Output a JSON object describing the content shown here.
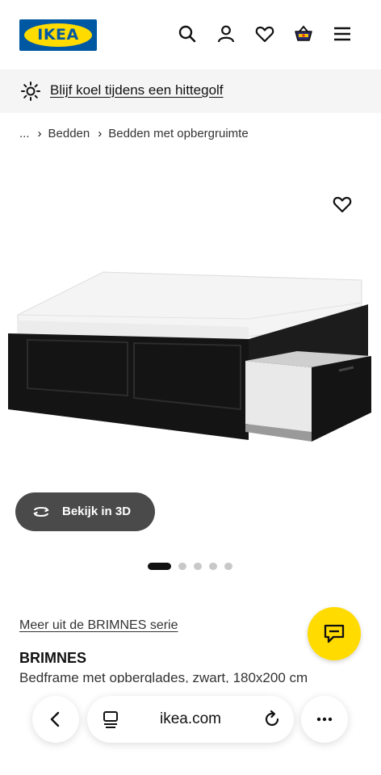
{
  "header": {
    "logo_text": "IKEA",
    "icons": [
      "search-icon",
      "account-icon",
      "favourites-icon",
      "basket-icon",
      "menu-icon"
    ],
    "brand_colors": {
      "blue": "#0058a3",
      "yellow": "#ffdb00"
    }
  },
  "banner": {
    "icon": "sun-icon",
    "text": "Blijf koel tijdens een hittegolf"
  },
  "breadcrumb": {
    "ellipsis": "...",
    "items": [
      "Bedden",
      "Bedden met opbergruimte"
    ]
  },
  "gallery": {
    "view_3d_label": "Bekijk in 3D",
    "image_count": 5,
    "active_image": 1
  },
  "product": {
    "series_link": "Meer uit de BRIMNES serie",
    "name": "BRIMNES",
    "description": "Bedframe met opberglades, zwart, 180x200 cm"
  },
  "browser": {
    "url": "ikea.com",
    "icons": [
      "back-icon",
      "tabs-icon",
      "reload-icon",
      "more-icon"
    ]
  }
}
